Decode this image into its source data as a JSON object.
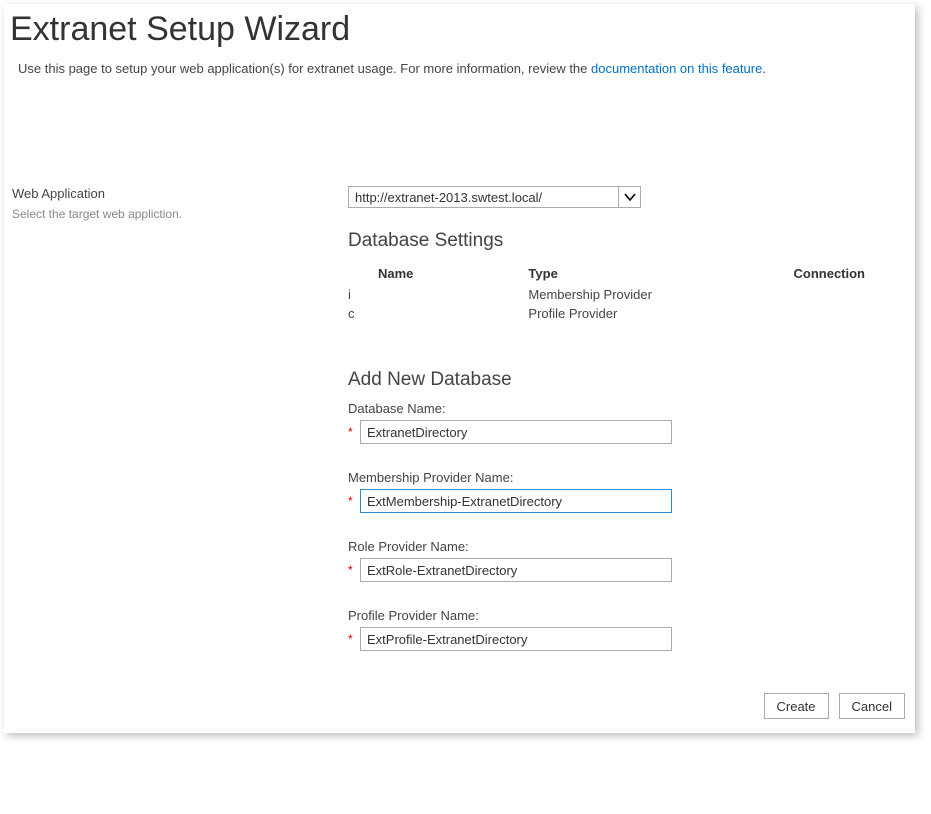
{
  "page": {
    "title": "Extranet Setup Wizard",
    "description_prefix": "Use this page to setup your web application(s) for extranet usage. For more information, review the ",
    "description_link": "documentation on this feature",
    "description_suffix": "."
  },
  "left": {
    "web_app_label": "Web Application",
    "web_app_help": "Select the target web appliction."
  },
  "web_app": {
    "selected": "http://extranet-2013.swtest.local/"
  },
  "database_settings": {
    "heading": "Database Settings",
    "columns": {
      "name": "Name",
      "type": "Type",
      "connection": "Connection"
    },
    "rows": [
      {
        "prefix": "i",
        "type": "Membership Provider"
      },
      {
        "prefix": "c",
        "type": "Profile Provider"
      }
    ]
  },
  "add_db": {
    "heading": "Add New Database",
    "fields": {
      "database_name": {
        "label": "Database Name:",
        "value": "ExtranetDirectory"
      },
      "membership": {
        "label": "Membership Provider Name:",
        "value": "ExtMembership-ExtranetDirectory"
      },
      "role": {
        "label": "Role Provider Name:",
        "value": "ExtRole-ExtranetDirectory"
      },
      "profile": {
        "label": "Profile Provider Name:",
        "value": "ExtProfile-ExtranetDirectory"
      }
    },
    "required_marker": "*"
  },
  "buttons": {
    "create": "Create",
    "cancel": "Cancel"
  }
}
